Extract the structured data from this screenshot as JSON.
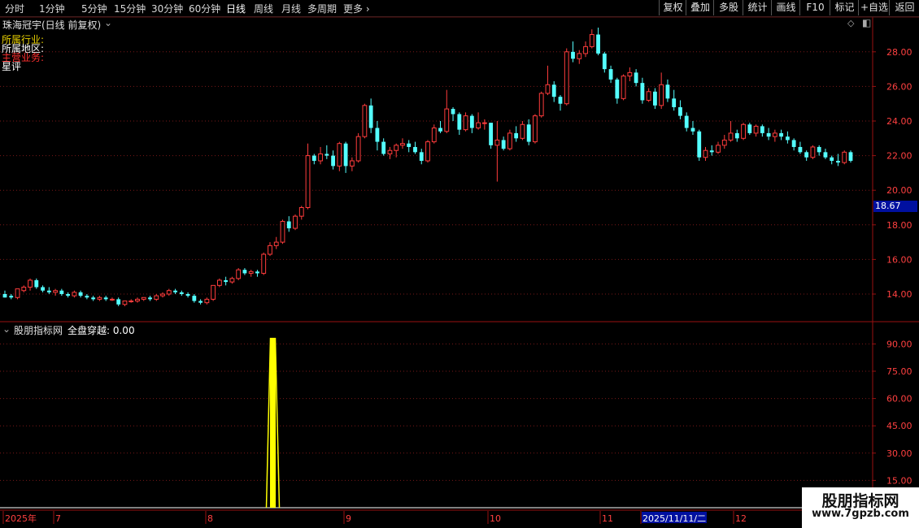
{
  "toolbar": {
    "periods": [
      "分时",
      "1分钟",
      "5分钟",
      "15分钟",
      "30分钟",
      "60分钟",
      "日线",
      "周线",
      "月线",
      "多周期",
      "更多"
    ],
    "active_period": "日线",
    "right_buttons": [
      "复权",
      "叠加",
      "多股",
      "统计",
      "画线",
      "F10",
      "标记",
      "+自选",
      "返回"
    ]
  },
  "stock": {
    "title": "珠海冠宇(日线 前复权)",
    "info_labels": [
      "所属行业:",
      "所属地区:",
      "主营业务:",
      "星评"
    ],
    "label_colors": [
      "#e8d000",
      "#ffffff",
      "#ff3030",
      "#ffffff"
    ]
  },
  "price_axis": {
    "ticks": [
      "28.00",
      "26.00",
      "24.00",
      "22.00",
      "20.00",
      "18.00",
      "16.00",
      "14.00"
    ],
    "current_price": "18.67"
  },
  "indicator": {
    "title": "股朋指标网",
    "formula": "全盘穿越: 0.00",
    "ticks": [
      "90.00",
      "75.00",
      "60.00",
      "45.00",
      "30.00",
      "15.00"
    ],
    "signal_value": 93
  },
  "time_axis": {
    "labels": [
      "2025年",
      "7",
      "8",
      "9",
      "10",
      "11",
      "2025/11/11/二",
      "12"
    ]
  },
  "watermark": {
    "line1": "股朋指标网",
    "line2": "www.7gpzb.com"
  },
  "colors": {
    "up": "#ff3c3c",
    "down": "#54ffff",
    "signal": "#ffff00",
    "grid": "#7a1818",
    "axis_text": "#ff4040"
  },
  "chart_data": {
    "type": "candlestick",
    "title": "珠海冠宇(日线 前复权)",
    "ylim": [
      13.2,
      29.6
    ],
    "candles": [
      [
        14.0,
        14.2,
        13.8,
        13.8
      ],
      [
        13.9,
        14.0,
        13.7,
        13.8
      ],
      [
        13.8,
        14.3,
        13.7,
        14.3
      ],
      [
        14.2,
        14.5,
        14.1,
        14.4
      ],
      [
        14.4,
        14.9,
        14.2,
        14.8
      ],
      [
        14.8,
        14.9,
        14.3,
        14.4
      ],
      [
        14.4,
        14.5,
        14.1,
        14.2
      ],
      [
        14.2,
        14.4,
        14.0,
        14.1
      ],
      [
        14.1,
        14.3,
        13.9,
        14.2
      ],
      [
        14.2,
        14.3,
        13.9,
        14.0
      ],
      [
        14.0,
        14.1,
        13.8,
        13.9
      ],
      [
        13.9,
        14.2,
        13.8,
        14.1
      ],
      [
        14.1,
        14.2,
        13.8,
        13.9
      ],
      [
        13.9,
        14.0,
        13.7,
        13.8
      ],
      [
        13.8,
        13.9,
        13.6,
        13.7
      ],
      [
        13.7,
        13.9,
        13.6,
        13.8
      ],
      [
        13.8,
        13.9,
        13.6,
        13.7
      ],
      [
        13.7,
        13.8,
        13.6,
        13.7
      ],
      [
        13.7,
        13.8,
        13.3,
        13.4
      ],
      [
        13.4,
        13.6,
        13.3,
        13.6
      ],
      [
        13.6,
        13.7,
        13.5,
        13.6
      ],
      [
        13.6,
        13.8,
        13.5,
        13.7
      ],
      [
        13.7,
        13.8,
        13.6,
        13.8
      ],
      [
        13.8,
        13.9,
        13.6,
        13.7
      ],
      [
        13.7,
        14.0,
        13.6,
        13.9
      ],
      [
        13.9,
        14.1,
        13.8,
        14.0
      ],
      [
        14.0,
        14.3,
        13.9,
        14.2
      ],
      [
        14.2,
        14.3,
        14.0,
        14.1
      ],
      [
        14.1,
        14.2,
        13.9,
        14.0
      ],
      [
        14.0,
        14.1,
        13.8,
        13.9
      ],
      [
        13.9,
        14.0,
        13.5,
        13.6
      ],
      [
        13.6,
        13.7,
        13.4,
        13.5
      ],
      [
        13.5,
        13.8,
        13.4,
        13.7
      ],
      [
        13.7,
        14.5,
        13.6,
        14.5
      ],
      [
        14.5,
        14.9,
        14.4,
        14.8
      ],
      [
        14.8,
        15.0,
        14.5,
        14.7
      ],
      [
        14.7,
        15.0,
        14.6,
        14.9
      ],
      [
        14.9,
        15.5,
        14.8,
        15.4
      ],
      [
        15.4,
        15.5,
        15.1,
        15.2
      ],
      [
        15.2,
        15.4,
        15.0,
        15.3
      ],
      [
        15.3,
        15.4,
        15.0,
        15.2
      ],
      [
        15.2,
        16.4,
        15.1,
        16.3
      ],
      [
        16.3,
        17.0,
        16.2,
        16.8
      ],
      [
        16.8,
        17.3,
        16.6,
        17.0
      ],
      [
        17.0,
        18.3,
        16.9,
        18.2
      ],
      [
        18.2,
        18.5,
        17.6,
        17.8
      ],
      [
        17.8,
        18.6,
        17.7,
        18.5
      ],
      [
        18.5,
        19.1,
        18.3,
        19.0
      ],
      [
        19.0,
        22.7,
        18.9,
        22.0
      ],
      [
        22.0,
        22.1,
        21.5,
        21.7
      ],
      [
        21.7,
        22.5,
        21.5,
        22.1
      ],
      [
        22.1,
        22.6,
        21.8,
        22.0
      ],
      [
        22.0,
        22.3,
        21.2,
        21.4
      ],
      [
        21.4,
        22.8,
        21.1,
        22.7
      ],
      [
        22.7,
        22.8,
        21.0,
        21.4
      ],
      [
        21.4,
        21.9,
        21.1,
        21.7
      ],
      [
        21.7,
        23.3,
        21.6,
        23.1
      ],
      [
        23.1,
        25.0,
        23.0,
        24.9
      ],
      [
        24.9,
        25.3,
        23.3,
        23.6
      ],
      [
        23.6,
        24.0,
        22.3,
        22.8
      ],
      [
        22.8,
        23.0,
        22.0,
        22.1
      ],
      [
        22.1,
        22.5,
        21.8,
        22.3
      ],
      [
        22.3,
        22.7,
        21.9,
        22.6
      ],
      [
        22.6,
        23.0,
        22.4,
        22.7
      ],
      [
        22.7,
        22.9,
        22.2,
        22.5
      ],
      [
        22.5,
        22.8,
        22.1,
        22.2
      ],
      [
        22.2,
        22.4,
        21.5,
        21.7
      ],
      [
        21.7,
        22.9,
        21.6,
        22.8
      ],
      [
        22.8,
        23.8,
        22.7,
        23.6
      ],
      [
        23.6,
        24.0,
        23.3,
        23.4
      ],
      [
        23.4,
        25.8,
        23.3,
        24.7
      ],
      [
        24.7,
        24.8,
        24.0,
        24.4
      ],
      [
        24.4,
        24.5,
        23.2,
        23.5
      ],
      [
        23.5,
        24.5,
        23.4,
        24.3
      ],
      [
        24.3,
        24.4,
        23.3,
        23.6
      ],
      [
        23.6,
        24.5,
        23.5,
        23.9
      ],
      [
        23.9,
        24.1,
        23.5,
        23.9
      ],
      [
        23.9,
        23.9,
        22.4,
        22.6
      ],
      [
        22.6,
        24.0,
        20.5,
        22.9
      ],
      [
        22.9,
        23.1,
        22.3,
        22.4
      ],
      [
        22.4,
        23.5,
        22.3,
        23.3
      ],
      [
        23.3,
        23.7,
        22.8,
        23.0
      ],
      [
        23.0,
        24.0,
        22.9,
        23.8
      ],
      [
        23.8,
        24.1,
        22.6,
        22.8
      ],
      [
        22.8,
        24.4,
        22.7,
        24.3
      ],
      [
        24.3,
        25.7,
        24.2,
        25.6
      ],
      [
        25.6,
        27.2,
        25.5,
        26.1
      ],
      [
        26.1,
        26.3,
        25.1,
        25.4
      ],
      [
        25.4,
        25.5,
        24.6,
        25.0
      ],
      [
        25.0,
        28.2,
        24.9,
        28.0
      ],
      [
        28.0,
        28.6,
        27.4,
        27.6
      ],
      [
        27.6,
        28.1,
        27.3,
        27.9
      ],
      [
        27.9,
        28.6,
        27.7,
        28.3
      ],
      [
        28.3,
        29.3,
        28.2,
        29.0
      ],
      [
        29.0,
        29.4,
        27.8,
        27.9
      ],
      [
        27.9,
        28.0,
        26.8,
        27.0
      ],
      [
        27.0,
        27.2,
        26.2,
        26.4
      ],
      [
        26.4,
        26.5,
        25.0,
        25.3
      ],
      [
        25.3,
        26.7,
        25.2,
        26.6
      ],
      [
        26.6,
        27.1,
        26.3,
        26.8
      ],
      [
        26.8,
        27.0,
        26.0,
        26.2
      ],
      [
        26.2,
        26.5,
        25.0,
        25.2
      ],
      [
        25.2,
        25.9,
        25.1,
        25.7
      ],
      [
        25.7,
        25.9,
        24.7,
        24.9
      ],
      [
        24.9,
        26.8,
        24.7,
        26.1
      ],
      [
        26.1,
        26.4,
        25.1,
        25.3
      ],
      [
        25.3,
        25.8,
        24.6,
        24.8
      ],
      [
        24.8,
        25.2,
        24.1,
        24.3
      ],
      [
        24.3,
        24.5,
        23.4,
        23.6
      ],
      [
        23.6,
        24.0,
        23.2,
        23.4
      ],
      [
        23.4,
        23.5,
        21.7,
        21.9
      ],
      [
        21.9,
        22.5,
        21.7,
        22.3
      ],
      [
        22.3,
        22.6,
        22.0,
        22.2
      ],
      [
        22.2,
        22.8,
        22.1,
        22.6
      ],
      [
        22.6,
        23.2,
        22.4,
        22.9
      ],
      [
        22.9,
        24.0,
        22.8,
        23.3
      ],
      [
        23.3,
        23.5,
        22.8,
        23.0
      ],
      [
        23.0,
        23.9,
        22.9,
        23.8
      ],
      [
        23.8,
        23.9,
        23.2,
        23.3
      ],
      [
        23.3,
        23.8,
        23.1,
        23.7
      ],
      [
        23.7,
        23.8,
        23.1,
        23.3
      ],
      [
        23.3,
        23.6,
        22.9,
        23.1
      ],
      [
        23.1,
        23.5,
        22.8,
        23.3
      ],
      [
        23.3,
        23.5,
        22.9,
        23.1
      ],
      [
        23.1,
        23.4,
        22.7,
        22.9
      ],
      [
        22.9,
        23.0,
        22.3,
        22.5
      ],
      [
        22.5,
        22.8,
        22.1,
        22.2
      ],
      [
        22.2,
        22.3,
        21.7,
        21.9
      ],
      [
        21.9,
        22.6,
        21.8,
        22.5
      ],
      [
        22.5,
        22.6,
        22.0,
        22.2
      ],
      [
        22.2,
        22.4,
        21.8,
        21.9
      ],
      [
        21.9,
        22.0,
        21.5,
        21.7
      ],
      [
        21.7,
        22.1,
        21.4,
        21.6
      ],
      [
        21.6,
        22.3,
        21.5,
        22.2
      ],
      [
        22.2,
        22.3,
        21.6,
        21.7
      ]
    ]
  }
}
